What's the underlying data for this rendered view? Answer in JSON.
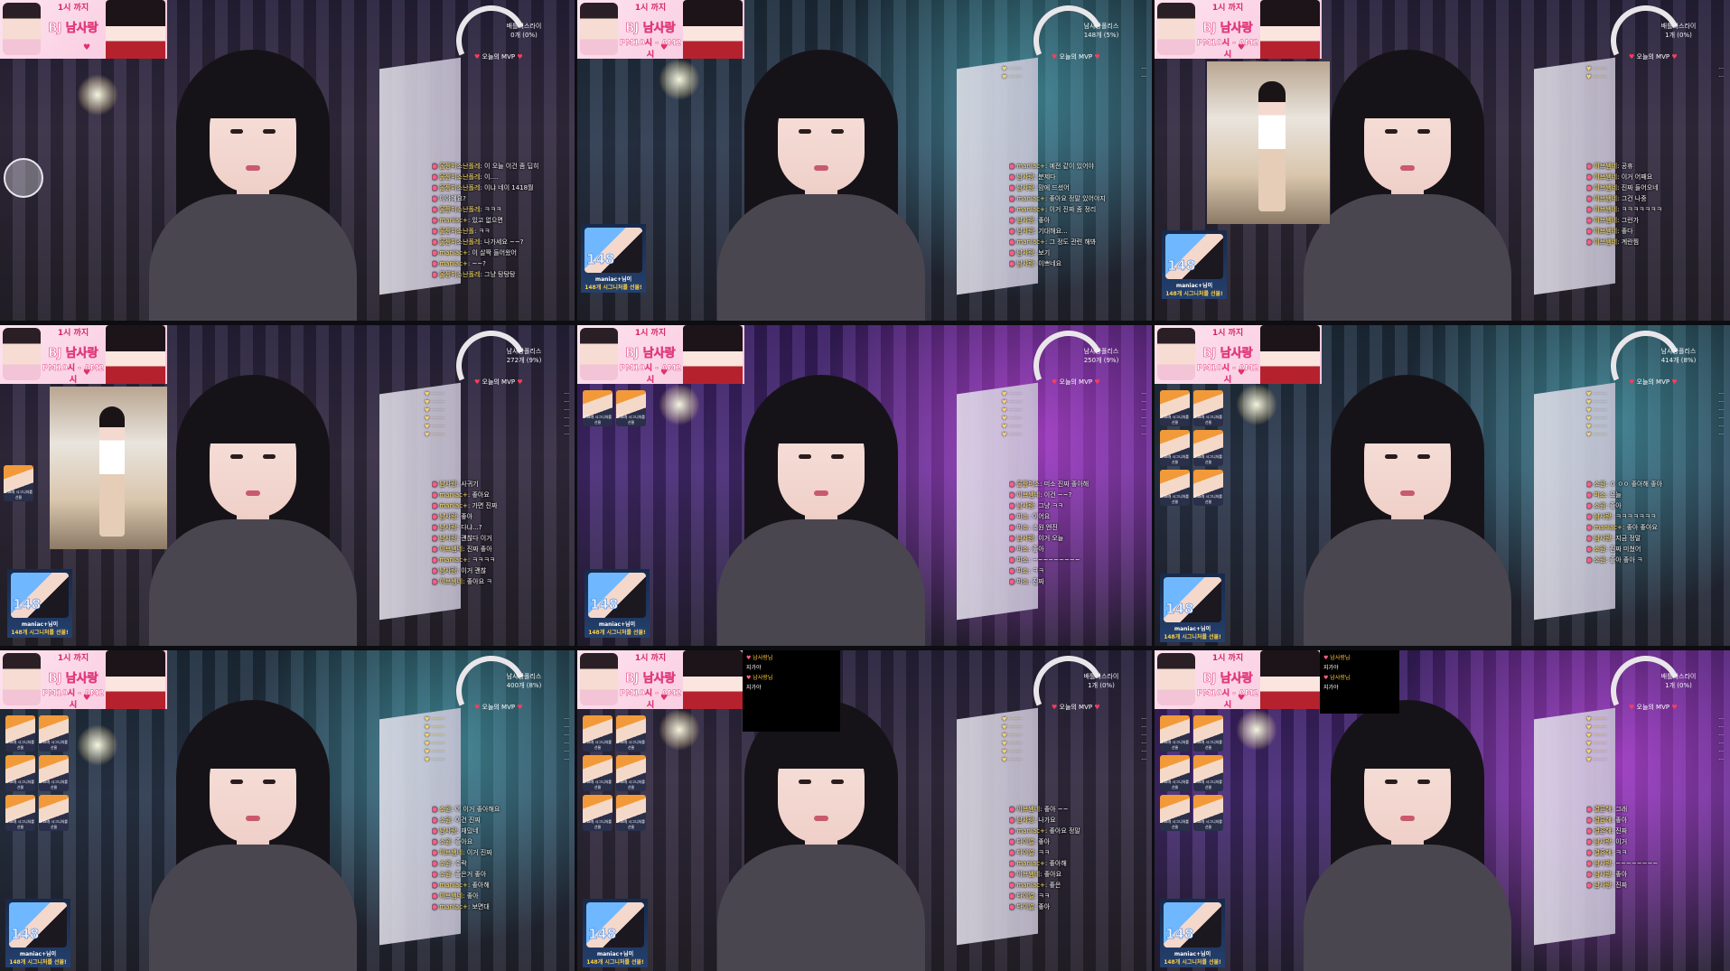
{
  "banner": {
    "title": "1시 까지",
    "main": "BJ 남사랑",
    "time": "PM10시 - AM2시"
  },
  "gauge_labels": [
    {
      "line1": "배틀리스라이",
      "line2": "0개 (0%)"
    },
    {
      "line1": "남사랑폴리스",
      "line2": "148개 (5%)"
    },
    {
      "line1": "배틀리스라이",
      "line2": "1개 (0%)"
    },
    {
      "line1": "남사랑폴리스",
      "line2": "272개 (9%)"
    },
    {
      "line1": "남사랑폴리스",
      "line2": "250개 (9%)"
    },
    {
      "line1": "남사랑폴리스",
      "line2": "414개 (8%)"
    },
    {
      "line1": "남사랑폴리스",
      "line2": "400개 (8%)"
    },
    {
      "line1": "배틀리스라이",
      "line2": "1개 (0%)"
    },
    {
      "line1": "배틀리스라이",
      "line2": "1개 (0%)"
    }
  ],
  "mvp_label": "오늘의 MVP",
  "signature": {
    "count": "148",
    "user": "maniac+님이",
    "message": "148개 시그니처를 선물!"
  },
  "chat": [
    [
      {
        "nick": "울짱미소난폴레",
        "msg": "이 오늘 이건 좀 딥히"
      },
      {
        "nick": "울짱미소난폴레",
        "msg": "이...."
      },
      {
        "nick": "울짱미소난폴레",
        "msg": "이냐 네이 1418월"
      },
      {
        "nick": "",
        "msg": "이야예요?"
      },
      {
        "nick": "울짱미소난폴레",
        "msg": "ㅋㅋㅋ"
      },
      {
        "nick": "maniac+",
        "msg": "있고 없으면"
      },
      {
        "nick": "울짱미소난폴",
        "msg": "ㅋㅋ"
      },
      {
        "nick": "울짱미소난폴레",
        "msg": "나가세요 ~~?"
      },
      {
        "nick": "maniac+",
        "msg": "이 살짝 들어왔어"
      },
      {
        "nick": "maniac+",
        "msg": "~~?"
      },
      {
        "nick": "울짱미소난폴레",
        "msg": "그냥 탕탕탕"
      }
    ],
    [
      {
        "nick": "maniac+",
        "msg": "예전 같이 있어야"
      },
      {
        "nick": "남사랑",
        "msg": "분제다"
      },
      {
        "nick": "남사랑",
        "msg": "맘에 드셨어"
      },
      {
        "nick": "maniac+",
        "msg": "좋아요 정말 있어야지"
      },
      {
        "nick": "maniac+",
        "msg": "이거 진짜 좀 정리"
      },
      {
        "nick": "남사랑",
        "msg": "좋아"
      },
      {
        "nick": "남사랑",
        "msg": "기대해요..."
      },
      {
        "nick": "maniac+",
        "msg": "그 정도 관련 해봐"
      },
      {
        "nick": "남사랑",
        "msg": "보기"
      },
      {
        "nick": "남사랑",
        "msg": "이쁘네요"
      }
    ],
    [
      {
        "nick": "이브쌤네",
        "msg": "공휴"
      },
      {
        "nick": "이브쌤네",
        "msg": "이거 어째요"
      },
      {
        "nick": "이브쌤네",
        "msg": "진짜 들어오네"
      },
      {
        "nick": "이브쌤네",
        "msg": "그건 나중"
      },
      {
        "nick": "이브쌤네",
        "msg": "ㅋㅋㅋㅋㅋㅋㅋ"
      },
      {
        "nick": "이브쌤네",
        "msg": "그런가"
      },
      {
        "nick": "이브쌤네",
        "msg": "좋다"
      },
      {
        "nick": "이브쌤네",
        "msg": "계란찜"
      }
    ],
    [
      {
        "nick": "남사랑",
        "msg": "사귀기"
      },
      {
        "nick": "maniac+",
        "msg": "좋아요"
      },
      {
        "nick": "maniac+",
        "msg": "가면 진짜"
      },
      {
        "nick": "남사랑",
        "msg": "좋아"
      },
      {
        "nick": "남사랑",
        "msg": "다냐...?"
      },
      {
        "nick": "남사랑",
        "msg": "괜찮다 이거"
      },
      {
        "nick": "이브쌤네",
        "msg": "진짜 좋아"
      },
      {
        "nick": "maniac+",
        "msg": "ㅋㅋㅋㅋ"
      },
      {
        "nick": "남사랑",
        "msg": "이거 괜찮"
      },
      {
        "nick": "이브쌤네",
        "msg": "좋아요 ㅋ"
      }
    ],
    [
      {
        "nick": "울짱미소",
        "msg": "미소 진짜 좋아해"
      },
      {
        "nick": "이브쌤네",
        "msg": "이건 ~~?"
      },
      {
        "nick": "남사랑",
        "msg": "그냥 ㅋㅋ"
      },
      {
        "nick": "미소",
        "msg": "이어요"
      },
      {
        "nick": "미소",
        "msg": "소원 엔진"
      },
      {
        "nick": "남사랑",
        "msg": "이거 오늘"
      },
      {
        "nick": "미소",
        "msg": "좋아"
      },
      {
        "nick": "미소",
        "msg": "~~~~~~~~~"
      },
      {
        "nick": "미소",
        "msg": "ㅋㅋ"
      },
      {
        "nick": "미소",
        "msg": "진짜"
      }
    ],
    [
      {
        "nick": "소원",
        "msg": "ㅇ ㅇㅇ 좋아해 좋아"
      },
      {
        "nick": "미소",
        "msg": "오늘"
      },
      {
        "nick": "소원",
        "msg": "좋아"
      },
      {
        "nick": "남사랑",
        "msg": "ㅋㅋㅋㅋㅋㅋㅋ"
      },
      {
        "nick": "maniac+",
        "msg": "좋아 좋아요"
      },
      {
        "nick": "남사랑",
        "msg": "지금 정말"
      },
      {
        "nick": "소원",
        "msg": "진짜 미쳤어"
      },
      {
        "nick": "소원",
        "msg": "좋아 좋아 ㅋ"
      }
    ],
    [
      {
        "nick": "소원",
        "msg": "어 이거 좋아해요"
      },
      {
        "nick": "소원",
        "msg": "이건 진짜"
      },
      {
        "nick": "남사랑",
        "msg": "재밌네"
      },
      {
        "nick": "소원",
        "msg": "좋아요"
      },
      {
        "nick": "이브쌤네",
        "msg": "이거 진짜"
      },
      {
        "nick": "소원",
        "msg": "수락"
      },
      {
        "nick": "소원",
        "msg": "좋은거 좋아"
      },
      {
        "nick": "maniac+",
        "msg": "좋아해"
      },
      {
        "nick": "이브쌤네",
        "msg": "좋아"
      },
      {
        "nick": "maniac+",
        "msg": "보면대"
      }
    ],
    [
      {
        "nick": "이브쌤네",
        "msg": "좋아 ~~"
      },
      {
        "nick": "남사랑",
        "msg": "나가요"
      },
      {
        "nick": "maniac+",
        "msg": "좋아요 정말"
      },
      {
        "nick": "다이얼",
        "msg": "좋아"
      },
      {
        "nick": "다이얼",
        "msg": "ㅋㅋ"
      },
      {
        "nick": "maniac+",
        "msg": "좋아해"
      },
      {
        "nick": "이브쌤네",
        "msg": "좋아요"
      },
      {
        "nick": "maniac+",
        "msg": "좋은"
      },
      {
        "nick": "다이얼",
        "msg": "ㅋㅋ"
      },
      {
        "nick": "다이얼",
        "msg": "좋아"
      }
    ],
    [
      {
        "nick": "결혼해",
        "msg": "그래"
      },
      {
        "nick": "결혼해",
        "msg": "좋아"
      },
      {
        "nick": "결혼해",
        "msg": "진짜"
      },
      {
        "nick": "남사랑",
        "msg": "이거"
      },
      {
        "nick": "결혼해",
        "msg": "ㅋㅋ"
      },
      {
        "nick": "남사랑",
        "msg": "~~~~~~~~"
      },
      {
        "nick": "남사랑",
        "msg": "좋아"
      },
      {
        "nick": "남사랑",
        "msg": "진짜"
      }
    ]
  ],
  "black_chat": [
    {
      "nick": "남사랑님",
      "text": "지가야"
    },
    {
      "nick": "남사랑님",
      "text": "지가야"
    }
  ],
  "sticker_label": "148개 시그니처를 선물"
}
